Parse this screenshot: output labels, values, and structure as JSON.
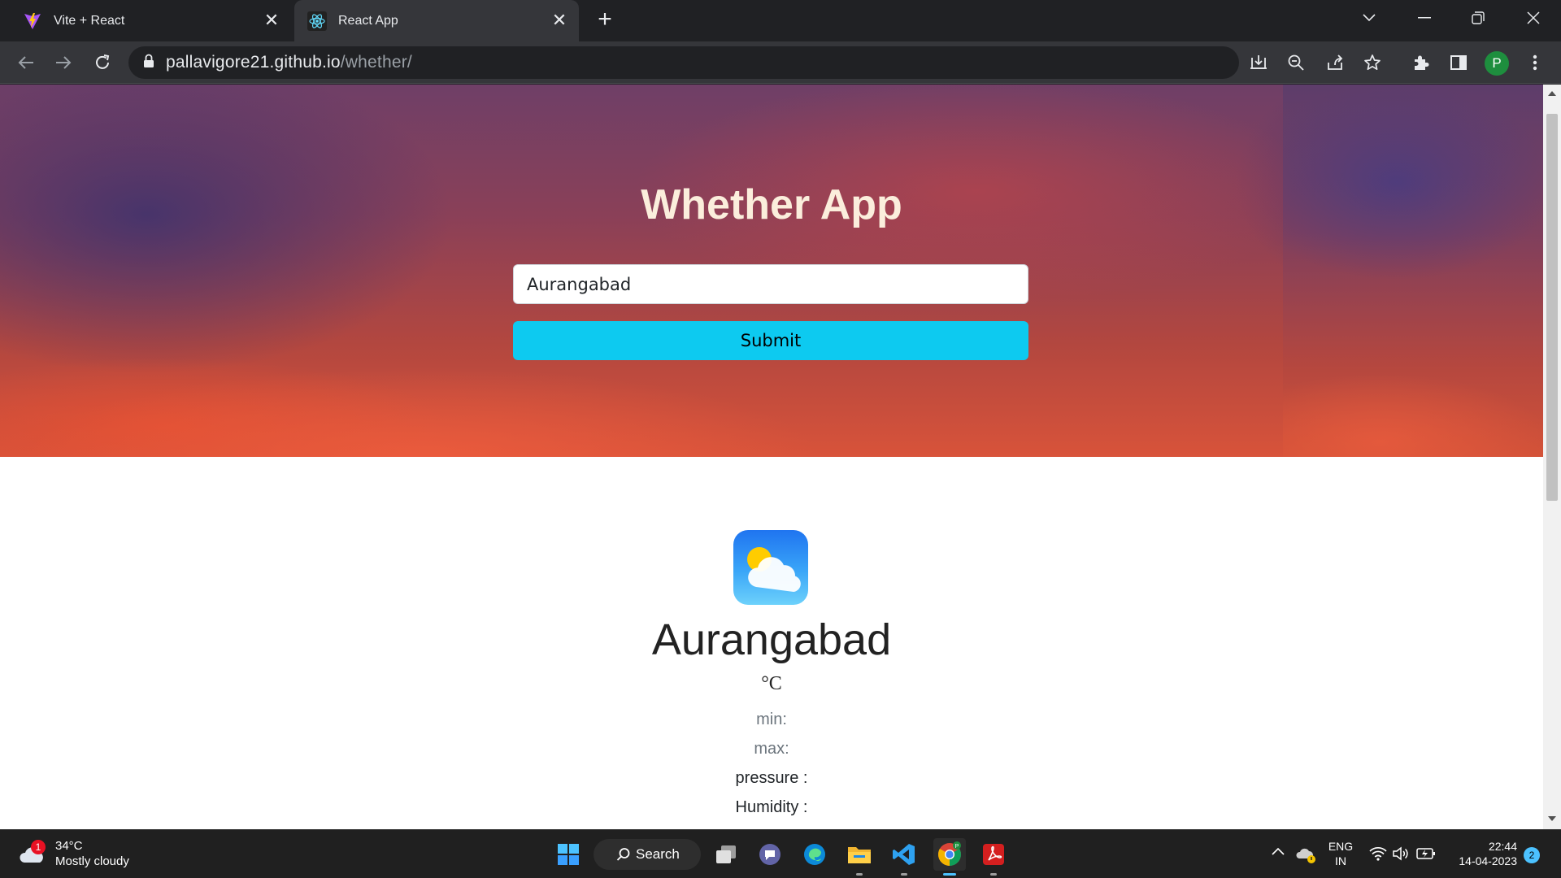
{
  "browser": {
    "tabs": [
      {
        "title": "Vite + React",
        "active": false
      },
      {
        "title": "React App",
        "active": true
      }
    ],
    "url_domain": "pallavigore21.github.io",
    "url_path": "/whether/",
    "profile_initial": "P"
  },
  "page": {
    "title": "Whether App",
    "search": {
      "value": "Aurangabad",
      "placeholder": ""
    },
    "submit_label": "Submit",
    "weather": {
      "city": "Aurangabad",
      "temp_unit": "°C",
      "min_label": "min:",
      "max_label": "max:",
      "pressure_label": "pressure :",
      "humidity_label": "Humidity :"
    }
  },
  "taskbar": {
    "weather_badge": "1",
    "weather_temp": "34°C",
    "weather_desc": "Mostly cloudy",
    "search_label": "Search",
    "lang_line1": "ENG",
    "lang_line2": "IN",
    "time": "22:44",
    "date": "14-04-2023",
    "notification_count": "2"
  },
  "colors": {
    "accent_button": "#0dcaf0",
    "title_text": "#fbeedc",
    "chrome_dark": "#202124",
    "chrome_toolbar": "#35363a"
  }
}
